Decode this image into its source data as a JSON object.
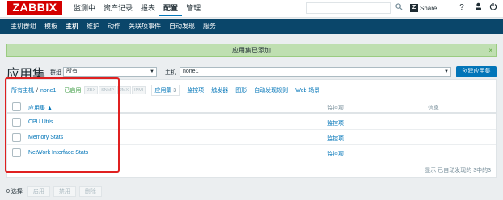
{
  "header": {
    "logo": "ZABBIX",
    "menu": [
      {
        "label": "监测中",
        "active": false
      },
      {
        "label": "资产记录",
        "active": false
      },
      {
        "label": "报表",
        "active": false
      },
      {
        "label": "配置",
        "active": true
      },
      {
        "label": "管理",
        "active": false
      }
    ],
    "search_placeholder": "",
    "share_label": "Share",
    "icons": [
      "search-icon",
      "zabbix-share-icon",
      "help-icon",
      "user-icon",
      "power-icon"
    ]
  },
  "subnav": {
    "items": [
      {
        "label": "主机群组",
        "active": false
      },
      {
        "label": "模板",
        "active": false
      },
      {
        "label": "主机",
        "active": true
      },
      {
        "label": "维护",
        "active": false
      },
      {
        "label": "动作",
        "active": false
      },
      {
        "label": "关联项事件",
        "active": false
      },
      {
        "label": "自动发现",
        "active": false
      },
      {
        "label": "服务",
        "active": false
      }
    ]
  },
  "message": {
    "text": "应用集已添加",
    "close": "×"
  },
  "page": {
    "title": "应用集",
    "group_label": "群组",
    "group_value": "所有",
    "host_label": "主机",
    "host_value": "none1",
    "create_button": "创建应用集"
  },
  "crumbs": {
    "all_hosts": "所有主机",
    "sep": "/",
    "host": "none1",
    "enabled": "已启用",
    "tags": [
      "ZBX",
      "SNMP",
      "JMX",
      "IPMI"
    ],
    "applications": "应用集",
    "applications_count": "3",
    "links": [
      "监控项",
      "触发器",
      "图形",
      "自动发现规则",
      "Web 场景"
    ]
  },
  "table": {
    "columns": {
      "name": "应用集 ▲",
      "items": "监控项",
      "info": "信息"
    },
    "rows": [
      {
        "name": "CPU Utils",
        "items": "监控项"
      },
      {
        "name": "Memory Stats",
        "items": "监控项"
      },
      {
        "name": "NetWork Interface Stats",
        "items": "监控项"
      }
    ],
    "footer": "显示 已自动发现的 3中的3"
  },
  "bottom": {
    "selected": "0 选择",
    "buttons": [
      "启用",
      "禁用",
      "删除"
    ]
  },
  "colors": {
    "brand": "#d40000",
    "subnav_bg": "#0a466a",
    "link": "#0275b8",
    "success_bg": "#bfdfb1",
    "highlight": "#e02020"
  }
}
